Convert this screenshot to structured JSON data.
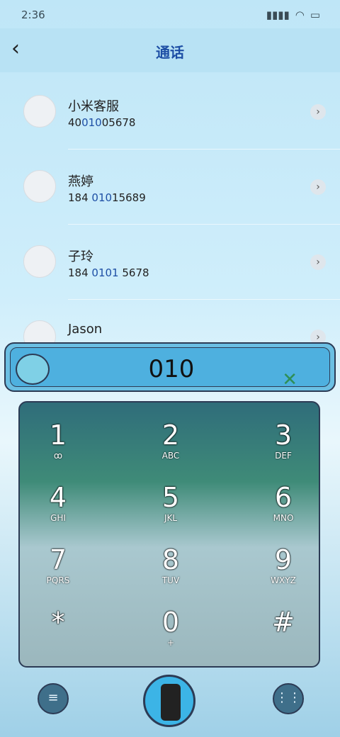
{
  "status": {
    "time": "2:36"
  },
  "header": {
    "title": "通话"
  },
  "contacts": [
    {
      "name": "小米客服",
      "number_pre": "40",
      "number_hl": "010",
      "number_post": "05678"
    },
    {
      "name": "燕婷",
      "number_pre": "184 ",
      "number_hl": "010",
      "number_post": "15689"
    },
    {
      "name": "子玲",
      "number_pre": "184 ",
      "number_hl": "0101",
      "number_post": " 5678"
    },
    {
      "name": "Jason",
      "number_pre": "",
      "number_hl": "",
      "number_post": ""
    }
  ],
  "dial": {
    "input": "010"
  },
  "keypad": [
    {
      "digit": "1",
      "letters": "ꝏ"
    },
    {
      "digit": "2",
      "letters": "ABC"
    },
    {
      "digit": "3",
      "letters": "DEF"
    },
    {
      "digit": "4",
      "letters": "GHI"
    },
    {
      "digit": "5",
      "letters": "JKL"
    },
    {
      "digit": "6",
      "letters": "MNO"
    },
    {
      "digit": "7",
      "letters": "PQRS"
    },
    {
      "digit": "8",
      "letters": "TUV"
    },
    {
      "digit": "9",
      "letters": "WXYZ"
    },
    {
      "digit": "*",
      "letters": ""
    },
    {
      "digit": "0",
      "letters": "+"
    },
    {
      "digit": "#",
      "letters": ""
    }
  ]
}
